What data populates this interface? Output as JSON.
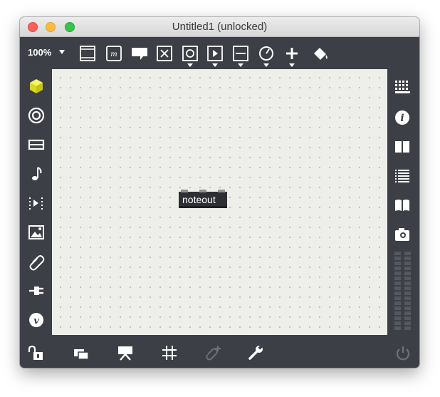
{
  "window": {
    "title": "Untitled1 (unlocked)"
  },
  "toolbar": {
    "zoom_label": "100%",
    "tools": [
      {
        "icon": "new-object-icon"
      },
      {
        "icon": "message-box-icon"
      },
      {
        "icon": "comment-icon"
      },
      {
        "icon": "toggle-icon"
      },
      {
        "icon": "button-icon",
        "has_menu": true
      },
      {
        "icon": "playbar-icon",
        "has_menu": true
      },
      {
        "icon": "slider-icon",
        "has_menu": true
      },
      {
        "icon": "dial-icon",
        "has_menu": true
      },
      {
        "icon": "plus-icon",
        "has_menu": true
      },
      {
        "icon": "paint-bucket-icon"
      }
    ]
  },
  "canvas": {
    "objects": [
      {
        "label": "noteout"
      }
    ]
  },
  "left_sidebar": {
    "icons": [
      "cube-icon",
      "target-icon",
      "synth-module-icon",
      "music-note-icon",
      "step-sequence-icon",
      "image-icon",
      "paperclip-icon",
      "plug-icon",
      "vizzie-icon"
    ],
    "active_color": "#e6e62a"
  },
  "right_sidebar": {
    "icons": [
      "grid-icon",
      "info-icon",
      "book-open-icon",
      "list-icon",
      "reference-book-icon",
      "camera-icon"
    ]
  },
  "bottom_bar": {
    "icons": [
      "lock-icon",
      "presentation-mode-icon",
      "projector-icon",
      "grid-icon",
      "add-clip-icon",
      "wrench-icon",
      "power-icon"
    ]
  },
  "colors": {
    "chrome": "#3c3f45",
    "canvas": "#eeeeea",
    "object_box": "#2e2f33",
    "icon": "#ffffff"
  }
}
